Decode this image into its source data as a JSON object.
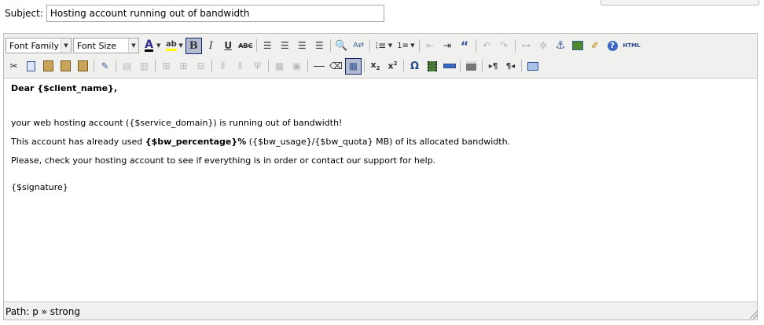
{
  "subject": {
    "label": "Subject:",
    "value": "Hosting account running out of bandwidth"
  },
  "toolbar": {
    "font_family": "Font Family",
    "font_size": "Font Size",
    "html_label": "HTML",
    "row1": [
      "text-color",
      "highlight-color",
      "bold",
      "italic",
      "underline",
      "strikethrough",
      "align-left",
      "align-center",
      "align-right",
      "align-justify",
      "find",
      "replace",
      "bullet-list",
      "numbered-list",
      "outdent",
      "indent",
      "blockquote",
      "undo",
      "redo",
      "link",
      "unlink",
      "anchor",
      "image",
      "cleanup",
      "help",
      "html-source"
    ],
    "row2": [
      "cut",
      "copy",
      "paste",
      "paste-text",
      "paste-word",
      "edit",
      "table-row",
      "table-col",
      "table-merge",
      "table-split",
      "table-delete",
      "insert-row",
      "insert-col",
      "horizontal-rule",
      "eraser",
      "visual-aid",
      "subscript",
      "superscript",
      "omega",
      "media",
      "rule",
      "print",
      "ltr",
      "rtl",
      "fullscreen"
    ]
  },
  "content": {
    "greeting_bold": "Dear {$client_name},",
    "line1": "your web hosting account ({$service_domain}) is running out of bandwidth!",
    "line2_pre": "This account has already used ",
    "line2_bold": "{$bw_percentage}%",
    "line2_post": " ({$bw_usage}/{$bw_quota} MB) of its allocated bandwidth.",
    "line3": "Please, check your hosting account to see if everything is in order or contact our support for help.",
    "signature": "{$signature}"
  },
  "status": {
    "path": "Path: p » strong"
  },
  "colors": {
    "toolbar_bg": "#f0f0ee",
    "active_border": "#0a246a",
    "icon_blue": "#3b5998"
  }
}
